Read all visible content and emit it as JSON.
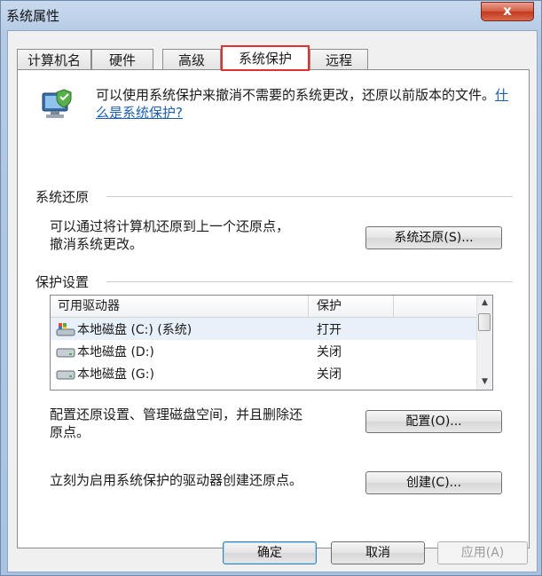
{
  "window": {
    "title": "系统属性",
    "close_label": "x"
  },
  "tabs": [
    {
      "label": "计算机名"
    },
    {
      "label": "硬件"
    },
    {
      "label": "高级"
    },
    {
      "label": "系统保护",
      "active": true
    },
    {
      "label": "远程"
    }
  ],
  "intro": {
    "text": "可以使用系统保护来撤消不需要的系统更改，还原以前版本的文件。",
    "link": "什么是系统保护?",
    "icon": "computer-shield-icon"
  },
  "restore": {
    "group_label": "系统还原",
    "description_line1": "可以通过将计算机还原到上一个还原点，",
    "description_line2": "撤消系统更改。",
    "button_label": "系统还原(S)..."
  },
  "protection": {
    "group_label": "保护设置",
    "columns": [
      "可用驱动器",
      "保护"
    ],
    "drives": [
      {
        "name": "本地磁盘 (C:) (系统)",
        "protection": "打开",
        "icon": "system-drive-icon"
      },
      {
        "name": "本地磁盘 (D:)",
        "protection": "关闭",
        "icon": "drive-icon"
      },
      {
        "name": "本地磁盘 (G:)",
        "protection": "关闭",
        "icon": "drive-icon"
      }
    ],
    "configure_line1": "配置还原设置、管理磁盘空间，并且删除还",
    "configure_line2": "原点。",
    "configure_button": "配置(O)...",
    "create_text": "立刻为启用系统保护的驱动器创建还原点。",
    "create_button": "创建(C)..."
  },
  "footer": {
    "ok": "确定",
    "cancel": "取消",
    "apply": "应用(A)"
  },
  "colors": {
    "active_tab_highlight": "#e0312c",
    "link": "#1d5fb0",
    "close_button": "#d25a40"
  }
}
